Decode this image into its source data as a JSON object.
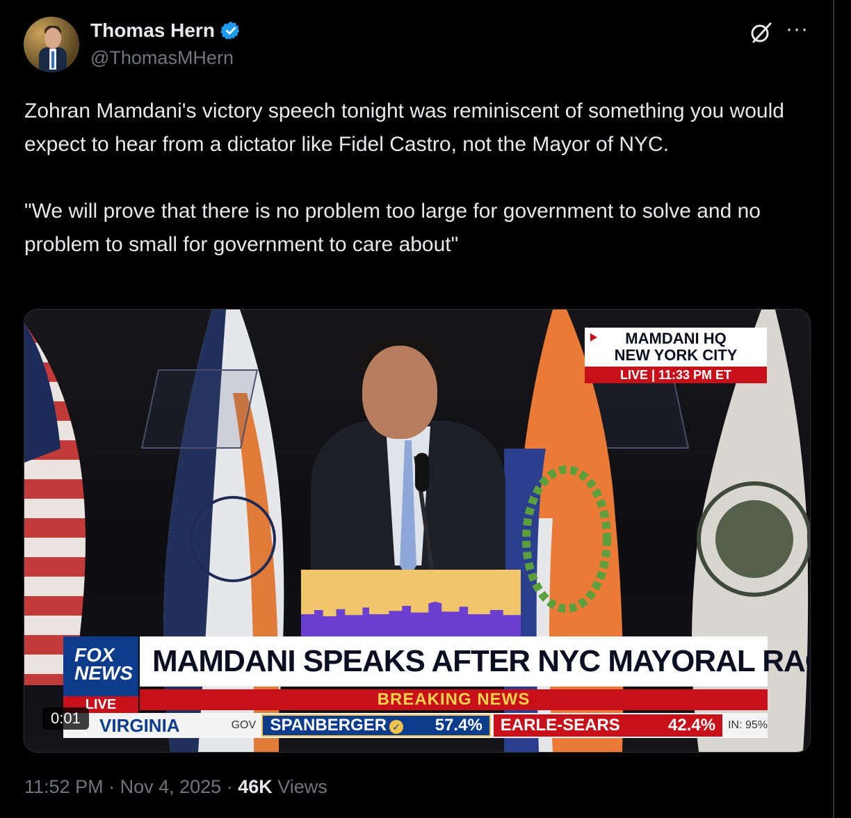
{
  "author": {
    "name": "Thomas Hern",
    "handle": "@ThomasMHern",
    "verified": true
  },
  "tweet": {
    "text": "Zohran Mamdani's victory speech tonight was reminiscent of something you would expect to hear from a dictator like Fidel Castro, not the Mayor of NYC.\n\n\"We will prove that there is no problem too large for government to solve and no problem to small for government to care about\""
  },
  "media": {
    "duration_badge": "0:01",
    "live_box": {
      "line1": "MAMDANI HQ",
      "line2": "NEW YORK CITY",
      "line3": "LIVE  |  11:33 PM ET"
    },
    "chyron": {
      "headline": "MAMDANI SPEAKS AFTER NYC MAYORAL RACE VICTORY",
      "breaking": "BREAKING NEWS",
      "logo_line1": "FOX",
      "logo_line2": "NEWS",
      "logo_live": "LIVE"
    },
    "ticker": {
      "state": "VIRGINIA",
      "race": "GOV",
      "dem_name": "SPANBERGER",
      "dem_pct": "57.4%",
      "rep_name": "EARLE-SEARS",
      "rep_pct": "42.4%",
      "reporting": "IN: 95%"
    }
  },
  "meta": {
    "time": "11:52 PM",
    "date": "Nov 4, 2025",
    "views_count": "46K",
    "views_label": "Views"
  },
  "colors": {
    "background": "#000000",
    "text": "#e7e9ea",
    "muted": "#71767b",
    "verified": "#1d9bf0",
    "fox_blue": "#0d3c8c",
    "fox_red": "#c7101a"
  },
  "icons": [
    "verified-badge-icon",
    "grok-icon",
    "more-icon"
  ]
}
